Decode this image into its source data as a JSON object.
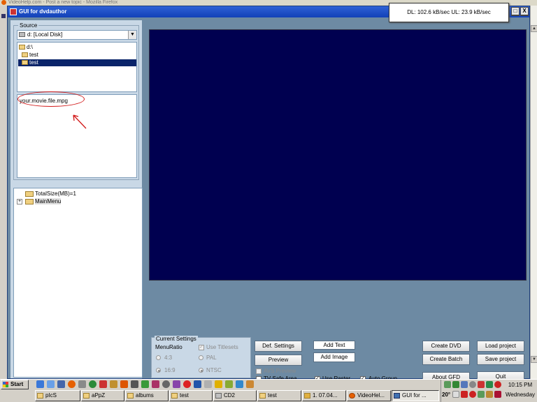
{
  "background_window": {
    "title": "VideoHelp.com - Post a new topic - Mozilla Firefox"
  },
  "window": {
    "title": "GUI for dvdauthor",
    "controls": {
      "minimize": "_",
      "maximize": "□",
      "close": "X"
    }
  },
  "source": {
    "label": "Source",
    "drive": "d: [Local Disk]",
    "dirs": [
      {
        "label": "d:\\",
        "selected": false
      },
      {
        "label": "test",
        "selected": false
      },
      {
        "label": "test",
        "selected": true
      }
    ],
    "files": [
      "your.movie.file.mpg"
    ]
  },
  "tree": {
    "nodes": [
      {
        "label": "TotalSize(MB)=1",
        "expandable": false
      },
      {
        "label": "MainMenu",
        "expandable": true,
        "expander": "+"
      }
    ]
  },
  "settings": {
    "label": "Current Settings",
    "menu_ratio": "MenuRatio",
    "ratio_43": "4:3",
    "ratio_169": "16:9",
    "use_titlesets": "Use Titlesets",
    "pal": "PAL",
    "ntsc": "NTSC"
  },
  "checks": {
    "avs_preview": "AVS Preview",
    "tv_safe_area": "TV Safe Area",
    "use_raster": "Use Raster",
    "auto_group": "Auto Group",
    "checkmark": "✓"
  },
  "buttons": {
    "def_settings": "Def. Settings",
    "preview": "Preview",
    "add_text": "Add Text",
    "add_image": "Add Image",
    "create_dvd": "Create DVD",
    "create_batch": "Create Batch",
    "about_gfd": "About GFD",
    "load_project": "Load project",
    "save_project": "Save project",
    "quit": "Quit"
  },
  "overlay": {
    "text": "DL: 102.6 kB/sec  UL: 23.9 kB/sec"
  },
  "taskbar": {
    "start": "Start",
    "buttons": [
      {
        "label": "pIcS",
        "active": false
      },
      {
        "label": "aPpZ",
        "active": false
      },
      {
        "label": "albums",
        "active": false
      },
      {
        "label": "test",
        "active": false
      },
      {
        "label": "CD2",
        "active": false
      },
      {
        "label": "test",
        "active": false
      },
      {
        "label": "1. 07.04...",
        "active": false
      },
      {
        "label": "VideoHel...",
        "active": false
      },
      {
        "label": "GUI for ...",
        "active": true
      }
    ],
    "tray_temp": "20°",
    "clock_time": "10:15 PM",
    "clock_day": "Wednesday"
  },
  "colors": {
    "preview_bg": "#000050",
    "annotation": "#d21a1a",
    "titlebar": "#1241b7"
  }
}
